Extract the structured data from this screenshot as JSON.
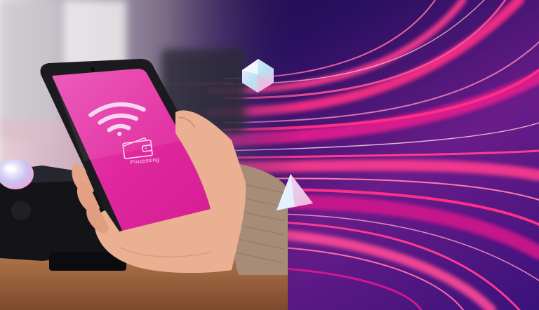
{
  "scene": {
    "phone_status_text": "Processing",
    "icons": [
      "wifi-icon",
      "wallet-icon"
    ],
    "colors": {
      "phone_screen": "#e0279e",
      "phone_screen_light": "#ef58bd",
      "icon_white": "#f9d6ef",
      "streak_pink": "#ff3a8e",
      "streak_magenta": "#d2178c",
      "background_navy": "#1a0a3a",
      "background_purple": "#5a1a86",
      "terminal_dark": "#141418",
      "counter_wood": "#b8773f",
      "hand_skin": "#eab091",
      "sweater_tan": "#a78c78"
    }
  }
}
